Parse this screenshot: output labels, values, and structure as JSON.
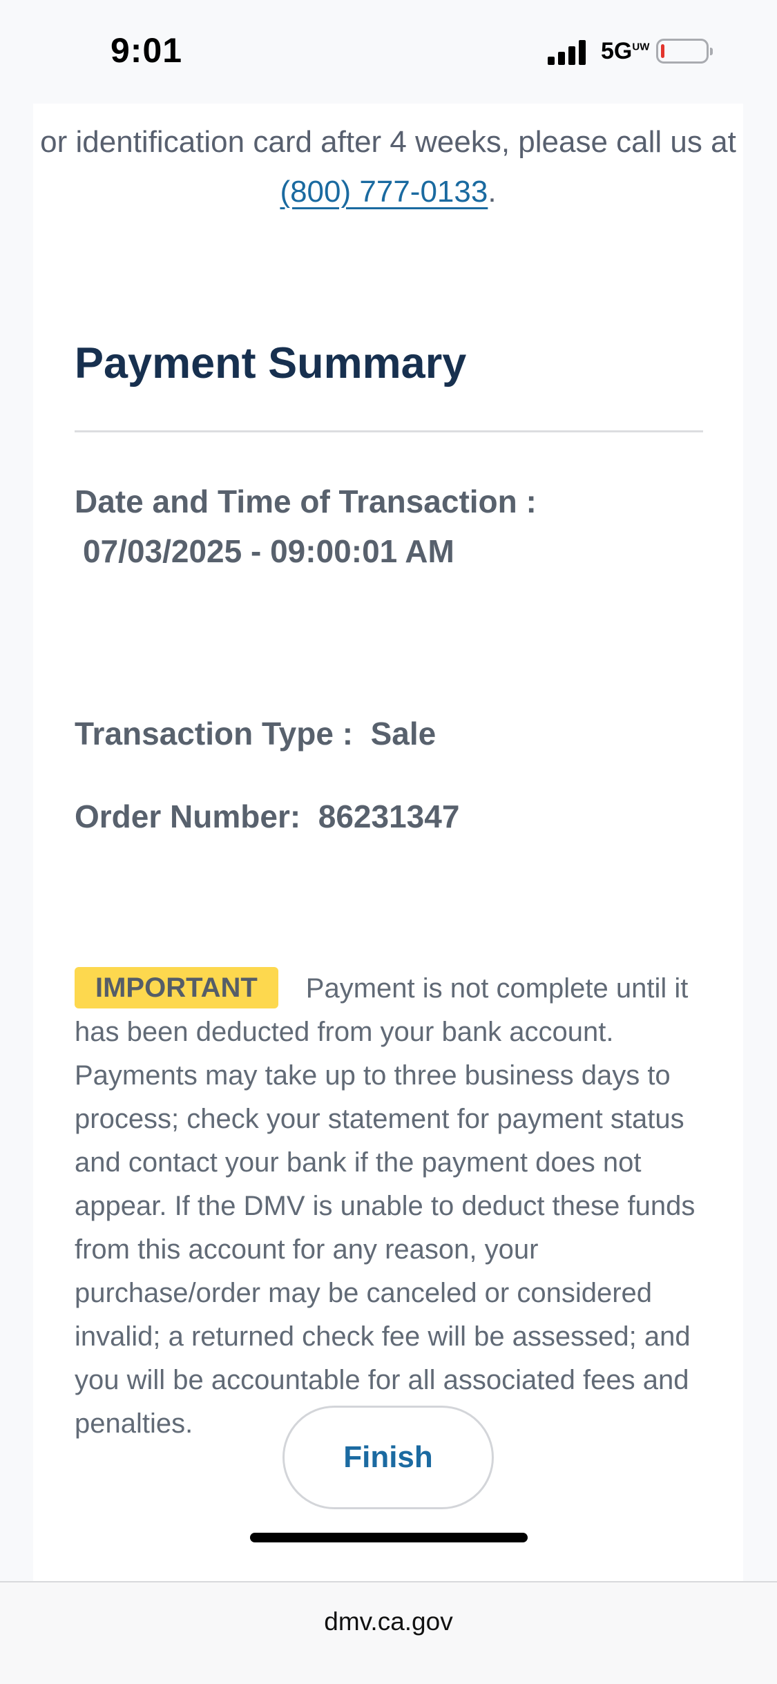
{
  "status_bar": {
    "time": "9:01",
    "network": "5G",
    "network_sup": "UW",
    "signal_icon": "signal-bars",
    "battery_icon": "battery-low",
    "battery_level": 0.08,
    "battery_color": "#e2352d"
  },
  "intro": {
    "text_before": "or identification card after 4 weeks, please call us at ",
    "phone": "(800) 777-0133",
    "text_after": "."
  },
  "summary": {
    "title": "Payment Summary",
    "datetime_label": "Date and Time of Transaction :",
    "datetime_value": "07/03/2025 - 09:00:01 AM",
    "type_label": "Transaction Type :",
    "type_value": "Sale",
    "order_label": "Order Number:",
    "order_value": "86231347"
  },
  "notice": {
    "badge": "IMPORTANT",
    "text": "Payment is not complete until it has been deducted from your bank account. Payments may take up to three business days to process; check your statement for payment status and contact your bank if the payment does not appear. If the DMV is unable to deduct these funds from this account for any reason, your purchase/order may be canceled or considered invalid; a returned check fee will be assessed; and you will be accountable for all associated fees and penalties."
  },
  "finish_label": "Finish",
  "browser": {
    "url": "dmv.ca.gov"
  },
  "colors": {
    "title": "#17304f",
    "link": "#1a6aa0",
    "badge": "#fdd84e",
    "body_text": "#58616d"
  }
}
